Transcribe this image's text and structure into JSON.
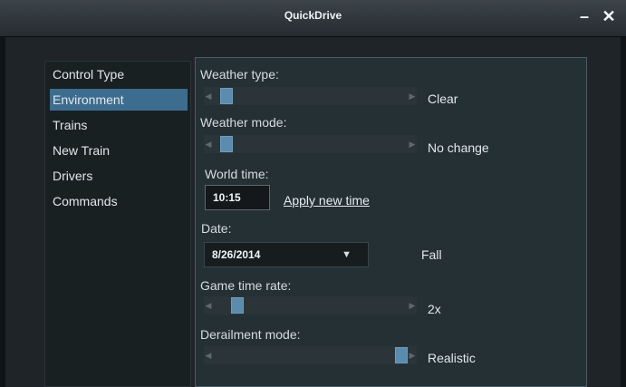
{
  "window": {
    "title": "QuickDrive",
    "minimize": "–",
    "close": "✕"
  },
  "sidebar": {
    "items": [
      {
        "label": "Control Type"
      },
      {
        "label": "Environment",
        "selected": true
      },
      {
        "label": "Trains"
      },
      {
        "label": "New Train"
      },
      {
        "label": "Drivers"
      },
      {
        "label": "Commands"
      }
    ]
  },
  "environment": {
    "weather_type": {
      "label": "Weather type:",
      "value": "Clear",
      "slider_level": 0.04
    },
    "weather_mode": {
      "label": "Weather mode:",
      "value": "No change",
      "slider_level": 0.04
    },
    "world_time": {
      "label": "World time:",
      "value": "10:15",
      "apply_label": "Apply new time"
    },
    "date": {
      "label": "Date:",
      "value": "8/26/2014",
      "season": "Fall",
      "dropdown_icon": "down-arrow"
    },
    "game_time_rate": {
      "label": "Game time rate:",
      "value": "2x",
      "slider_level": 0.1
    },
    "derailment_mode": {
      "label": "Derailment mode:",
      "value": "Realistic",
      "slider_level": 1.0
    }
  },
  "colors": {
    "accent": "#3d6d8e",
    "panel": "#243034",
    "thumb": "#5b8cae"
  }
}
